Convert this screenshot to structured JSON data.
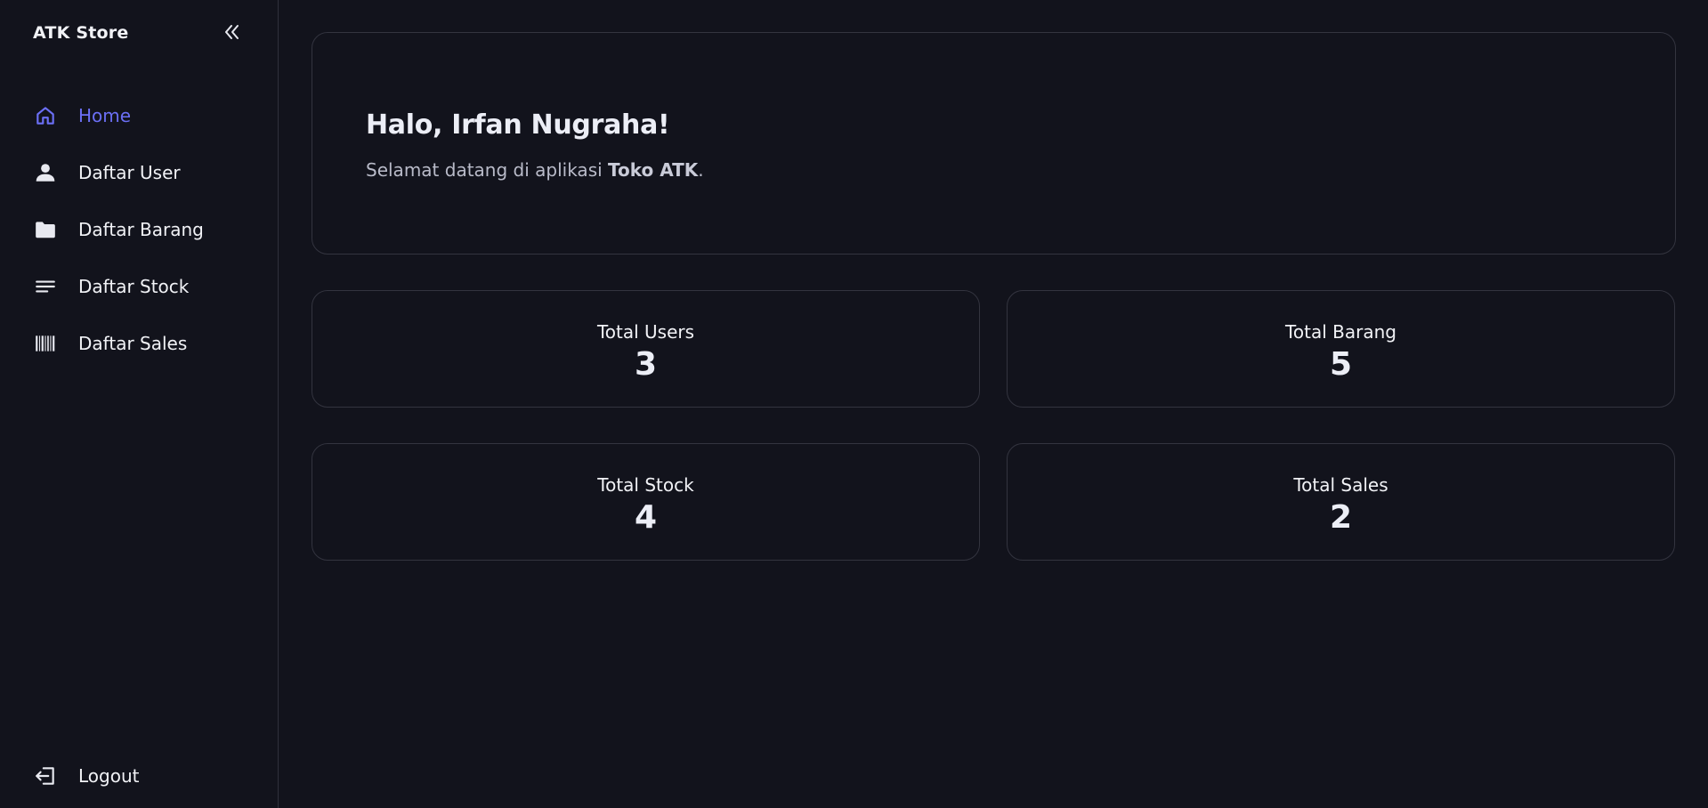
{
  "sidebar": {
    "brand": "ATK Store",
    "collapse_icon": "double-chevron-left-icon",
    "items": [
      {
        "label": "Home",
        "icon": "home-icon",
        "active": true
      },
      {
        "label": "Daftar User",
        "icon": "user-icon"
      },
      {
        "label": "Daftar Barang",
        "icon": "folder-icon"
      },
      {
        "label": "Daftar Stock",
        "icon": "list-lines-icon"
      },
      {
        "label": "Daftar Sales",
        "icon": "barcode-icon"
      }
    ],
    "logout": {
      "label": "Logout",
      "icon": "logout-icon"
    }
  },
  "welcome": {
    "greeting": "Halo, Irfan Nugraha!",
    "message_prefix": "Selamat datang di aplikasi ",
    "app_name": "Toko ATK",
    "message_suffix": "."
  },
  "stats": [
    {
      "label": "Total Users",
      "value": "3"
    },
    {
      "label": "Total Barang",
      "value": "5"
    },
    {
      "label": "Total Stock",
      "value": "4"
    },
    {
      "label": "Total Sales",
      "value": "2"
    }
  ],
  "colors": {
    "background": "#12131c",
    "border": "#33343f",
    "accent": "#6b6ff5",
    "text": "#f1f2f6"
  }
}
